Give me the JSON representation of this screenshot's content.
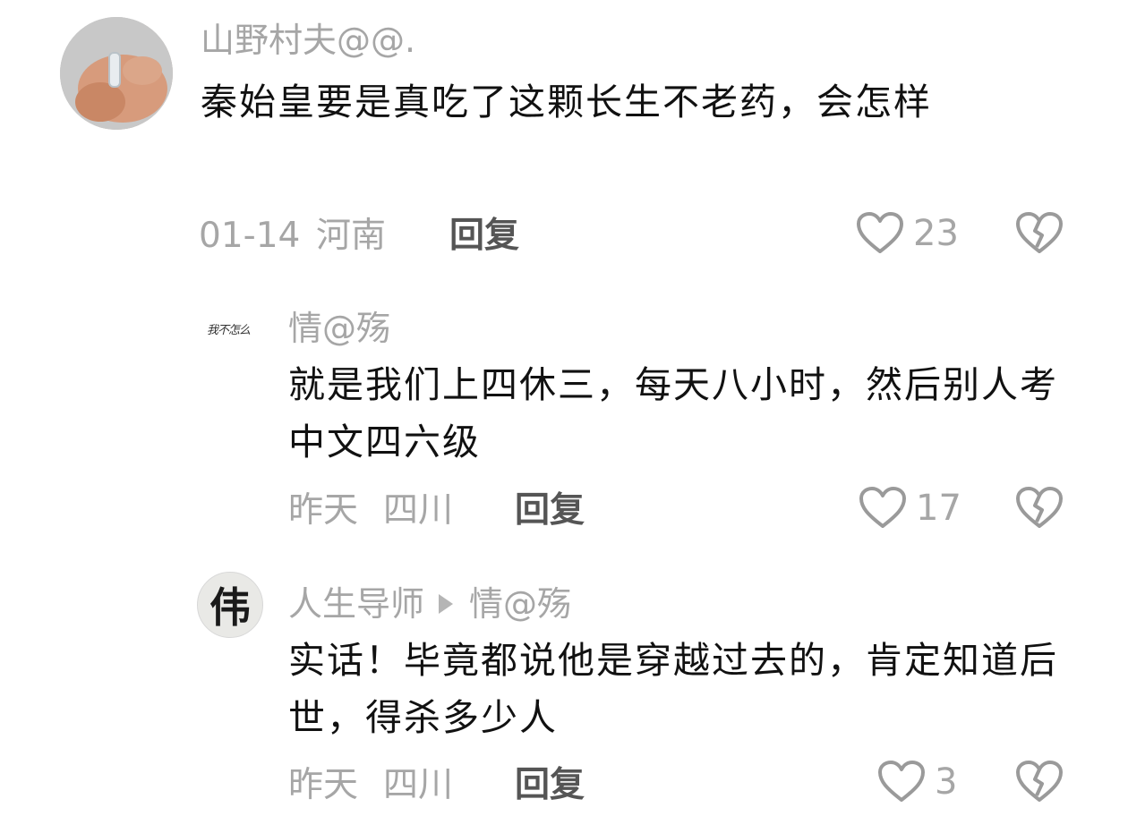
{
  "comments": [
    {
      "username": "山野村夫@@.",
      "text": "秦始皇要是真吃了这颗长生不老药，会怎样",
      "date": "01-14",
      "region": "河南",
      "reply_label": "回复",
      "likes": "23"
    },
    {
      "username": "情@殇",
      "avatar_text": "我不怎么",
      "text": "就是我们上四休三，每天八小时，然后别人考中文四六级",
      "date": "昨天",
      "region": "四川",
      "reply_label": "回复",
      "likes": "17"
    },
    {
      "username": "人生导师",
      "reply_to": "情@殇",
      "avatar_text": "伟",
      "text": "实话！毕竟都说他是穿越过去的，肯定知道后世，得杀多少人",
      "date": "昨天",
      "region": "四川",
      "reply_label": "回复",
      "likes": "3"
    }
  ],
  "colors": {
    "meta_gray": "#a6a6a6",
    "text_dark": "#111111",
    "reply_gray": "#555555",
    "icon_gray": "#9a9a9a"
  },
  "icons": [
    "heart-outline-icon",
    "broken-heart-icon",
    "reply-arrow-icon"
  ]
}
